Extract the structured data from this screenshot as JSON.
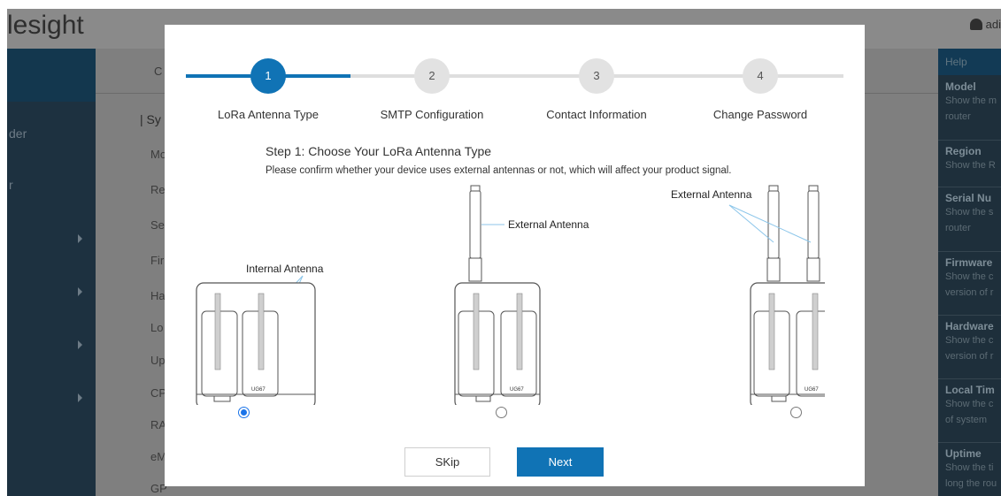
{
  "background": {
    "logo": "lesight",
    "user": "adi",
    "tab": "C",
    "section": "| Sy",
    "nav": {
      "item1": "der",
      "item2": "r"
    },
    "rows": [
      "Mo",
      "Re",
      "Se",
      "Fir",
      "Ha",
      "Lo",
      "Up",
      "CP",
      "RA",
      "eM",
      "GP"
    ],
    "help": {
      "title": "Help",
      "items": [
        {
          "title": "Model",
          "desc1": "Show the m",
          "desc2": "router"
        },
        {
          "title": "Region",
          "desc1": "Show the R",
          "desc2": ""
        },
        {
          "title": "Serial Nu",
          "desc1": "Show the s",
          "desc2": "router"
        },
        {
          "title": "Firmware",
          "desc1": "Show the c",
          "desc2": "version of r"
        },
        {
          "title": "Hardware",
          "desc1": "Show the c",
          "desc2": "version of r"
        },
        {
          "title": "Local Tim",
          "desc1": "Show the c",
          "desc2": "of system"
        },
        {
          "title": "Uptime",
          "desc1": "Show the ti",
          "desc2": "long the rou"
        }
      ]
    }
  },
  "wizard": {
    "steps": [
      {
        "number": "1",
        "label": "LoRa Antenna Type"
      },
      {
        "number": "2",
        "label": "SMTP Configuration"
      },
      {
        "number": "3",
        "label": "Contact Information"
      },
      {
        "number": "4",
        "label": "Change Password"
      }
    ],
    "title": "Step 1: Choose Your LoRa Antenna Type",
    "description": "Please confirm whether your device uses external antennas or not, which will affect your product signal.",
    "options": [
      {
        "annotation": "Internal Antenna",
        "model": "UG67",
        "selected": true
      },
      {
        "annotation": "External Antenna",
        "model": "UG67",
        "selected": false
      },
      {
        "annotation": "External Antenna",
        "model": "UG67",
        "selected": false
      }
    ],
    "buttons": {
      "skip": "SKip",
      "next": "Next"
    },
    "colors": {
      "accent": "#1073b5",
      "step_inactive": "#e2e2e2",
      "radio": "#1a73e8"
    }
  }
}
